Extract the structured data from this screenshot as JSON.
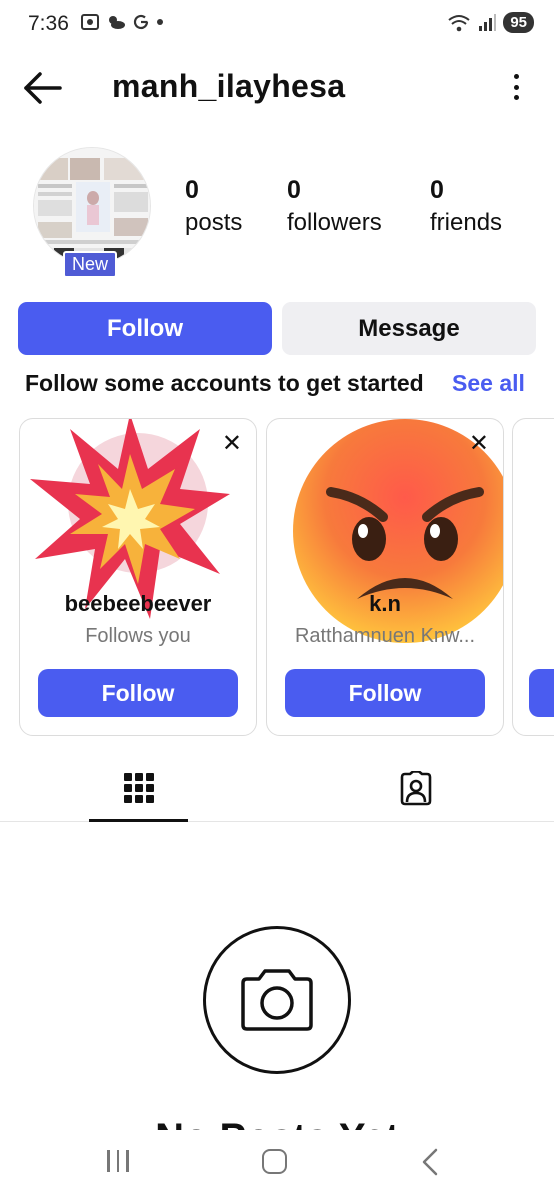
{
  "status_bar": {
    "time": "7:36",
    "battery": "95"
  },
  "header": {
    "username": "manh_ilayhesa"
  },
  "profile": {
    "new_badge": "New",
    "stats": [
      {
        "num": "0",
        "label": "posts"
      },
      {
        "num": "0",
        "label": "followers"
      },
      {
        "num": "0",
        "label": "friends"
      }
    ]
  },
  "actions": {
    "follow_label": "Follow",
    "message_label": "Message"
  },
  "suggestions": {
    "title": "Follow some accounts to get started",
    "see_all": "See all",
    "cards": [
      {
        "name": "beebeebeever",
        "subtitle": "Follows you",
        "follow_label": "Follow",
        "close": "✕"
      },
      {
        "name": "k.n",
        "subtitle": "Ratthamnuen Knw...",
        "follow_label": "Follow",
        "close": "✕"
      }
    ]
  },
  "empty_state": {
    "title": "No Posts Yet"
  },
  "colors": {
    "accent": "#4a5cf0",
    "secondary_button": "#efeff2"
  }
}
